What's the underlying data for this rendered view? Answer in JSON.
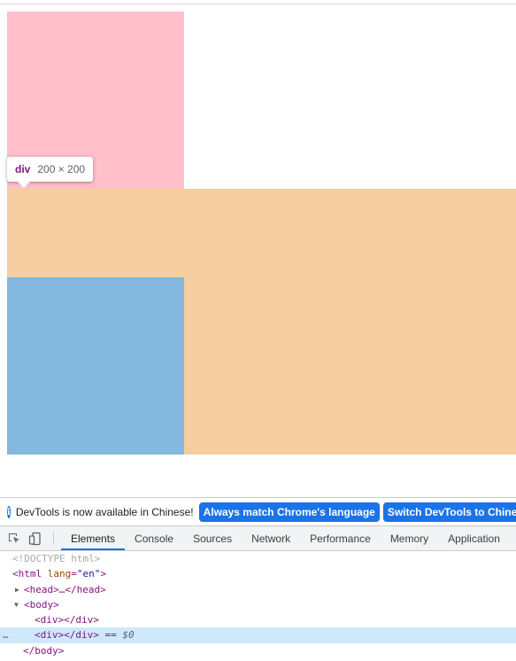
{
  "page": {
    "boxes": [
      {
        "name": "pink",
        "color": "#ffc0cb"
      },
      {
        "name": "orange",
        "color": "#f6cda0"
      },
      {
        "name": "blue",
        "color": "#85b8de"
      }
    ],
    "tooltip": {
      "tag": "div",
      "size": "200 × 200"
    }
  },
  "devtools": {
    "infobar": {
      "message": "DevTools is now available in Chinese!",
      "btn_match": "Always match Chrome's language",
      "btn_switch": "Switch DevTools to Chinese",
      "icon": "info-icon"
    },
    "toolbar_icons": [
      "inspect-element-icon",
      "device-toolbar-icon"
    ],
    "tabs": [
      "Elements",
      "Console",
      "Sources",
      "Network",
      "Performance",
      "Memory",
      "Application"
    ],
    "active_tab": "Elements",
    "tree": {
      "doctype": "<!DOCTYPE html>",
      "html_open": "<html",
      "lang_attr": "lang",
      "lang_eq": "=",
      "lang_val": "\"en\"",
      "html_close": ">",
      "head": "<head>…</head>",
      "body_open": "<body>",
      "div1": "<div></div>",
      "div2": "<div></div>",
      "eq_text": "==",
      "dollar": "$0",
      "body_close": "</body>",
      "dots": "…"
    },
    "accent_color": "#1a73e8",
    "selection_color": "#cfe8fc"
  }
}
